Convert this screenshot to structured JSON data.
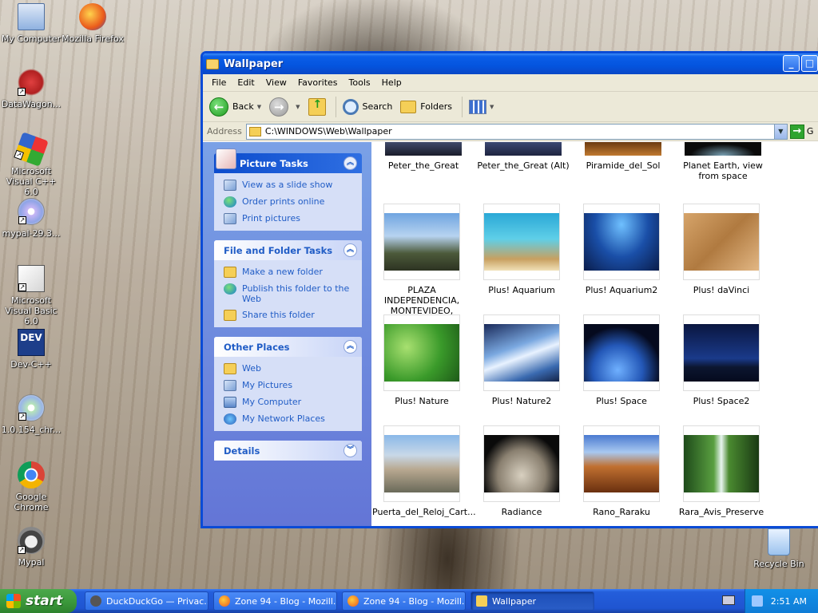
{
  "desktop": {
    "icons": [
      {
        "label": "My Computer"
      },
      {
        "label": "Mozilla Firefox"
      },
      {
        "label": "DataWagon..."
      },
      {
        "label": "Microsoft Visual C++ 6.0"
      },
      {
        "label": "mypal-29.3..."
      },
      {
        "label": "Microsoft Visual Basic 6.0"
      },
      {
        "label": "Dev-C++"
      },
      {
        "label": "1.0.154_chr..."
      },
      {
        "label": "Google Chrome"
      },
      {
        "label": "Mypal"
      },
      {
        "label": "Recycle Bin"
      }
    ],
    "dev_badge": "DEV"
  },
  "window": {
    "title": "Wallpaper",
    "controls": {
      "minimize": "_",
      "maximize": "□"
    },
    "menu": [
      "File",
      "Edit",
      "View",
      "Favorites",
      "Tools",
      "Help"
    ],
    "toolbar": {
      "back": "Back",
      "search": "Search",
      "folders": "Folders"
    },
    "address": {
      "label": "Address",
      "path": "C:\\WINDOWS\\Web\\Wallpaper",
      "go": "G"
    },
    "taskpane": {
      "picture_tasks": {
        "title": "Picture Tasks",
        "items": [
          "View as a slide show",
          "Order prints online",
          "Print pictures"
        ]
      },
      "file_folder_tasks": {
        "title": "File and Folder Tasks",
        "items": [
          "Make a new folder",
          "Publish this folder to the Web",
          "Share this folder"
        ]
      },
      "other_places": {
        "title": "Other Places",
        "items": [
          "Web",
          "My Pictures",
          "My Computer",
          "My Network Places"
        ]
      },
      "details": {
        "title": "Details"
      }
    },
    "files": [
      {
        "name": "Peter_the_Great"
      },
      {
        "name": "Peter_the_Great (Alt)"
      },
      {
        "name": "Piramide_del_Sol"
      },
      {
        "name": "Planet Earth, view from space"
      },
      {
        "name": "PLAZA INDEPENDENCIA, MONTEVIDEO, URUGUAY"
      },
      {
        "name": "Plus! Aquarium"
      },
      {
        "name": "Plus! Aquarium2"
      },
      {
        "name": "Plus! daVinci"
      },
      {
        "name": "Plus! Nature"
      },
      {
        "name": "Plus! Nature2"
      },
      {
        "name": "Plus! Space"
      },
      {
        "name": "Plus! Space2"
      },
      {
        "name": "Puerta_del_Reloj_Cart..."
      },
      {
        "name": "Radiance"
      },
      {
        "name": "Rano_Raraku"
      },
      {
        "name": "Rara_Avis_Preserve"
      }
    ]
  },
  "taskbar": {
    "start": "start",
    "tasks": [
      {
        "label": "DuckDuckGo — Privac..."
      },
      {
        "label": "Zone 94 - Blog - Mozill..."
      },
      {
        "label": "Zone 94 - Blog - Mozill..."
      },
      {
        "label": "Wallpaper"
      }
    ],
    "clock": "2:51 AM"
  }
}
